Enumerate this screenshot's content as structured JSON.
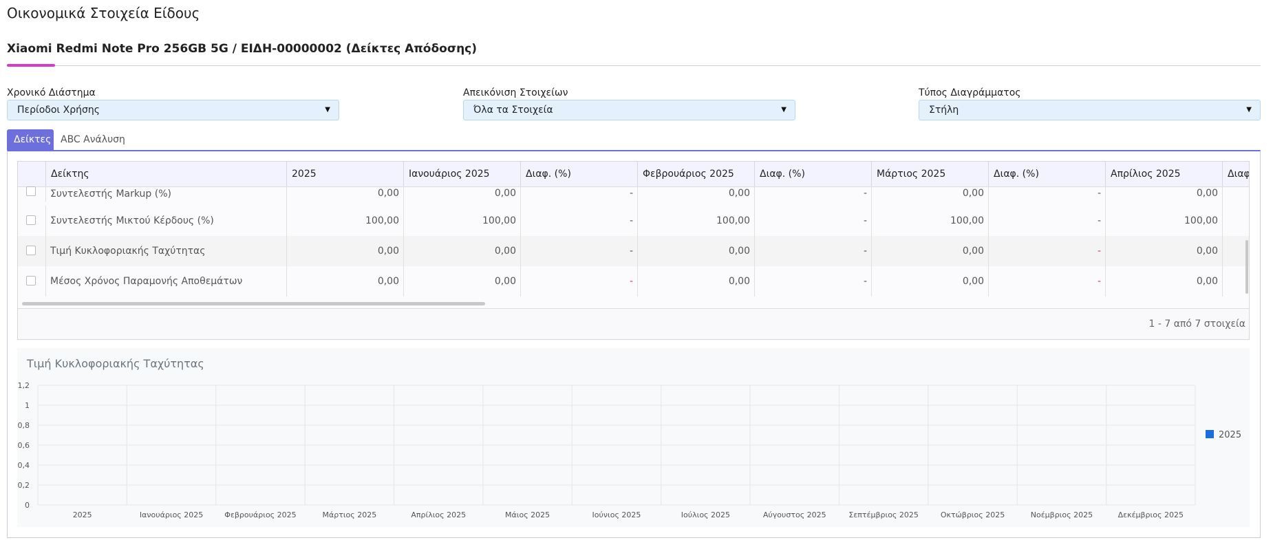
{
  "page": {
    "title": "Οικονομικά Στοιχεία Είδους",
    "subtitle": "Xiaomi Redmi Note Pro 256GB 5G / ΕΙΔΗ-00000002 (Δείκτες Απόδοσης)"
  },
  "filters": {
    "period": {
      "label": "Χρονικό Διάστημα",
      "value": "Περίοδοι Χρήσης"
    },
    "display": {
      "label": "Απεικόνιση Στοιχείων",
      "value": "Όλα τα Στοιχεία"
    },
    "chart_type": {
      "label": "Τύπος Διαγράμματος",
      "value": "Στήλη"
    }
  },
  "tabs": [
    {
      "label": "Δείκτες",
      "active": true
    },
    {
      "label": "ABC Ανάλυση",
      "active": false
    }
  ],
  "grid": {
    "columns": [
      "Δείκτης",
      "2025",
      "Ιανουάριος 2025",
      "Διαφ. (%)",
      "Φεβρουάριος 2025",
      "Διαφ. (%)",
      "Μάρτιος 2025",
      "Διαφ. (%)",
      "Απρίλιος 2025",
      "Διαφ. (%)"
    ],
    "rows": [
      {
        "name": "Συντελεστής Markup (%)",
        "v2025": "0,00",
        "jan": "0,00",
        "d1": "-",
        "feb": "0,00",
        "d2": "-",
        "mar": "0,00",
        "d3": "-",
        "apr": "0,00"
      },
      {
        "name": "Συντελεστής Μικτού Κέρδους (%)",
        "v2025": "100,00",
        "jan": "100,00",
        "d1": "-",
        "feb": "100,00",
        "d2": "-",
        "mar": "100,00",
        "d3": "-",
        "apr": "100,00"
      },
      {
        "name": "Τιμή Κυκλοφοριακής Ταχύτητας",
        "v2025": "0,00",
        "jan": "0,00",
        "d1": "-",
        "feb": "0,00",
        "d2": "-",
        "mar": "0,00",
        "d3": "-",
        "apr": "0,00"
      },
      {
        "name": "Μέσος Χρόνος Παραμονής Αποθεμάτων",
        "v2025": "0,00",
        "jan": "0,00",
        "d1": "-",
        "feb": "0,00",
        "d2": "-",
        "mar": "0,00",
        "d3": "-",
        "apr": "0,00"
      }
    ],
    "pager": "1 - 7 από 7 στοιχεία"
  },
  "colors": {
    "accent": "#6d6fdc",
    "title_underline": "#d63bc7",
    "series": "#1a6fe0",
    "negative_dash": "#d0414b"
  },
  "chart_data": {
    "type": "bar",
    "title": "Τιμή Κυκλοφοριακής Ταχύτητας",
    "categories": [
      "2025",
      "Ιανουάριος 2025",
      "Φεβρουάριος 2025",
      "Μάρτιος 2025",
      "Απρίλιος 2025",
      "Μάιος 2025",
      "Ιούνιος 2025",
      "Ιούλιος 2025",
      "Αύγουστος 2025",
      "Σεπτέμβριος 2025",
      "Οκτώβριος 2025",
      "Νοέμβριος 2025",
      "Δεκέμβριος 2025"
    ],
    "series": [
      {
        "name": "2025",
        "values": [
          0,
          0,
          0,
          0,
          0,
          0,
          0,
          0,
          0,
          0,
          0,
          0,
          0
        ]
      }
    ],
    "yticks": [
      "0",
      "0,2",
      "0,4",
      "0,6",
      "0,8",
      "1",
      "1,2"
    ],
    "ylim": [
      0,
      1.2
    ],
    "grid": true,
    "legend": "right"
  }
}
